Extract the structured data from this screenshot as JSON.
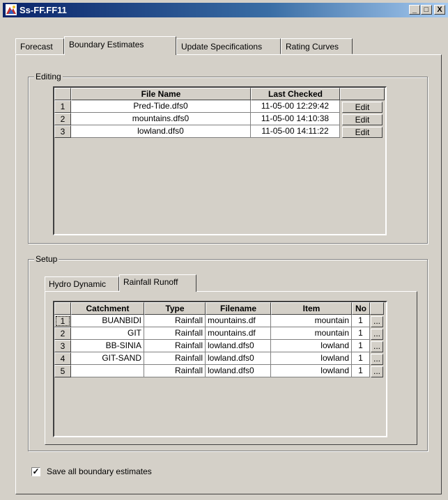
{
  "window": {
    "title": "Ss-FF.FF11",
    "min_label": "_",
    "max_label": "□",
    "close_label": "X"
  },
  "tabs": [
    "Forecast",
    "Boundary Estimates",
    "Update Specifications",
    "Rating Curves"
  ],
  "editing": {
    "legend": "Editing",
    "headers": {
      "file_name": "File Name",
      "last_checked": "Last Checked"
    },
    "rows": [
      {
        "num": "1",
        "file": "Pred-Tide.dfs0",
        "checked": "11-05-00 12:29:42",
        "action": "Edit"
      },
      {
        "num": "2",
        "file": "mountains.dfs0",
        "checked": "11-05-00 14:10:38",
        "action": "Edit"
      },
      {
        "num": "3",
        "file": "lowland.dfs0",
        "checked": "11-05-00 14:11:22",
        "action": "Edit"
      }
    ]
  },
  "setup": {
    "legend": "Setup",
    "tabs": [
      "Hydro Dynamic",
      "Rainfall Runoff"
    ],
    "headers": {
      "catchment": "Catchment",
      "type": "Type",
      "filename": "Filename",
      "item": "Item",
      "no": "No"
    },
    "rows": [
      {
        "num": "1",
        "catchment": "BUANBIDI",
        "type": "Rainfall",
        "filename": "mountains.df",
        "item": "mountain",
        "no": "1",
        "browse": "..."
      },
      {
        "num": "2",
        "catchment": "GIT",
        "type": "Rainfall",
        "filename": "mountains.df",
        "item": "mountain",
        "no": "1",
        "browse": "..."
      },
      {
        "num": "3",
        "catchment": "BB-SINIA",
        "type": "Rainfall",
        "filename": "lowland.dfs0",
        "item": "lowland",
        "no": "1",
        "browse": "..."
      },
      {
        "num": "4",
        "catchment": "GIT-SAND",
        "type": "Rainfall",
        "filename": "lowland.dfs0",
        "item": "lowland",
        "no": "1",
        "browse": "..."
      },
      {
        "num": "5",
        "catchment": "",
        "type": "Rainfall",
        "filename": "lowland.dfs0",
        "item": "lowland",
        "no": "1",
        "browse": "..."
      }
    ]
  },
  "save_all": {
    "label": "Save all boundary estimates",
    "checked": true,
    "mark": "✓"
  }
}
